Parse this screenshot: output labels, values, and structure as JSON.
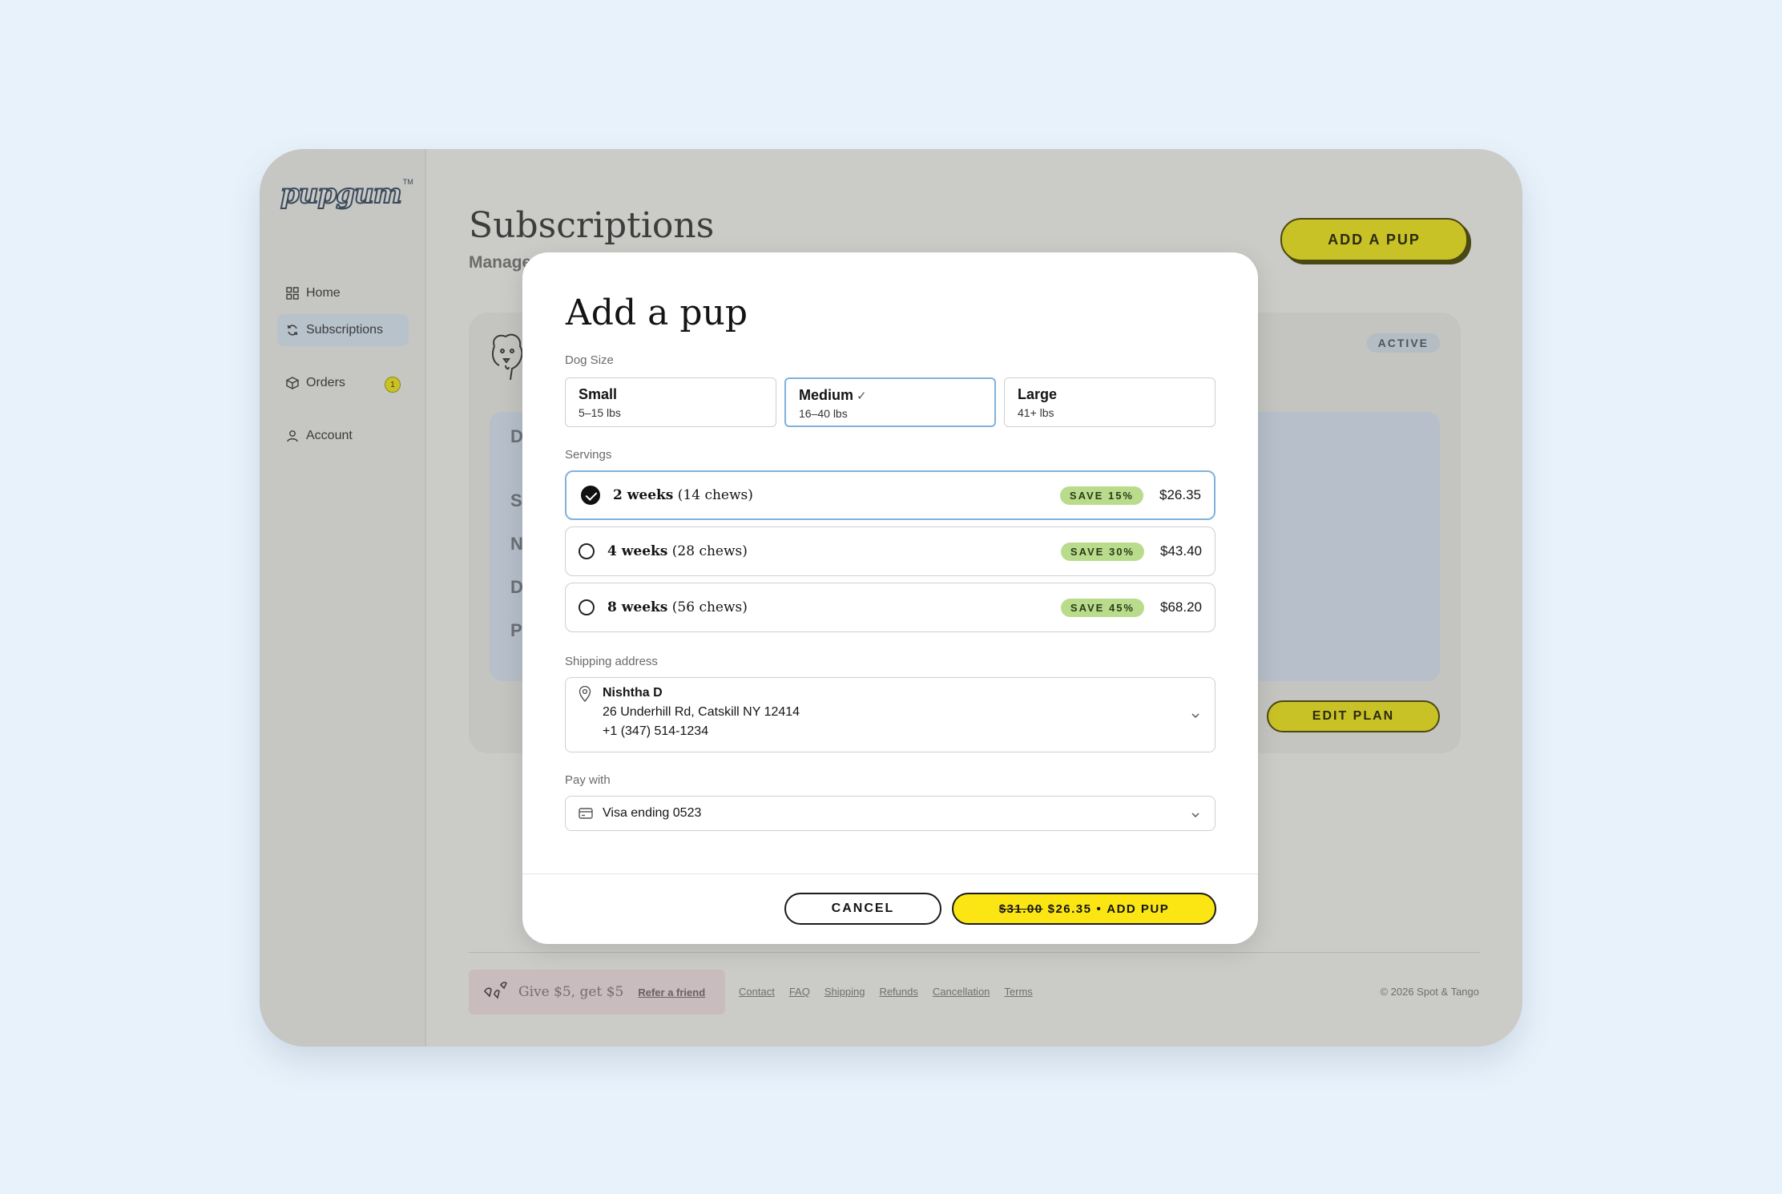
{
  "brand": {
    "logo_text": "pupgum",
    "tm": "TM"
  },
  "sidebar": {
    "items": [
      {
        "label": "Home",
        "icon": "grid-icon"
      },
      {
        "label": "Subscriptions",
        "icon": "refresh-icon",
        "active": true
      },
      {
        "label": "Orders",
        "icon": "box-icon",
        "badge": "1"
      },
      {
        "label": "Account",
        "icon": "user-icon"
      }
    ]
  },
  "page": {
    "title": "Subscriptions",
    "subtitle": "Manage",
    "add_pup_label": "ADD A PUP",
    "card": {
      "status": "ACTIVE",
      "row_initials": [
        "D",
        "S",
        "N",
        "D",
        "P"
      ],
      "edit_plan_label": "EDIT PLAN"
    }
  },
  "footer": {
    "referral_text": "Give $5, get $5",
    "referral_link": "Refer a friend",
    "links": [
      "Contact",
      "FAQ",
      "Shipping",
      "Refunds",
      "Cancellation",
      "Terms"
    ],
    "copyright": "© 2026 Spot & Tango"
  },
  "modal": {
    "title": "Add a pup",
    "dog_size_label": "Dog Size",
    "sizes": [
      {
        "name": "Small",
        "range": "5–15 lbs"
      },
      {
        "name": "Medium",
        "range": "16–40 lbs",
        "selected": true,
        "check": "✓"
      },
      {
        "name": "Large",
        "range": "41+ lbs"
      }
    ],
    "servings_label": "Servings",
    "servings": [
      {
        "weeks": "2 weeks",
        "chews": "(14 chews)",
        "save": "SAVE 15%",
        "price": "$26.35",
        "selected": true
      },
      {
        "weeks": "4 weeks",
        "chews": "(28 chews)",
        "save": "SAVE 30%",
        "price": "$43.40"
      },
      {
        "weeks": "8 weeks",
        "chews": "(56 chews)",
        "save": "SAVE 45%",
        "price": "$68.20"
      }
    ],
    "shipping_label": "Shipping address",
    "address": {
      "name": "Nishtha D",
      "street": "26 Underhill Rd, Catskill NY 12414",
      "phone": "+1 (347) 514-1234"
    },
    "pay_label": "Pay with",
    "payment": "Visa ending 0523",
    "cancel_label": "CANCEL",
    "add_button": {
      "old_price": "$31.00",
      "new_price": "$26.35",
      "sep": "•",
      "label": "ADD PUP"
    }
  },
  "colors": {
    "background": "#e8f2fb",
    "accent_yellow": "#fbe614",
    "selected_border": "#7fb2dd",
    "save_badge": "#b9dc8c"
  }
}
